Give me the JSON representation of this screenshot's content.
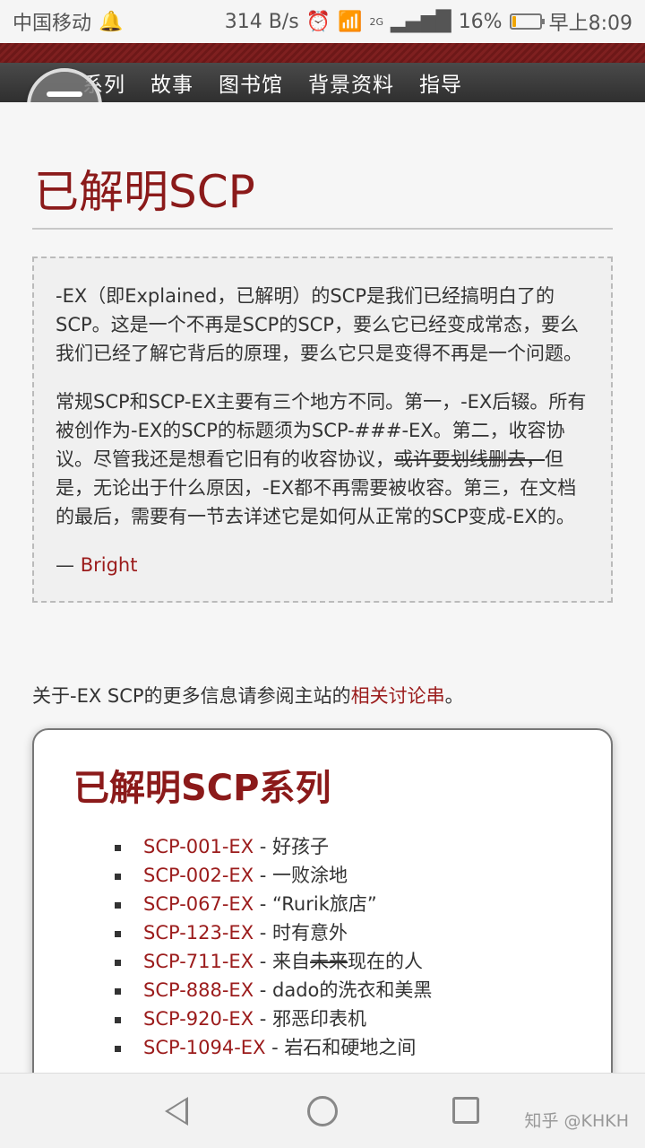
{
  "status": {
    "carrier": "中国移动",
    "speed": "314 B/s",
    "network_tag": "2G",
    "battery_pct": "16%",
    "time": "早上8:09",
    "battery_level": 0.16,
    "battery_color": "#f0a500"
  },
  "nav": {
    "items": [
      "系列",
      "故事",
      "图书馆",
      "背景资料",
      "指导"
    ]
  },
  "page": {
    "title": "已解明SCP",
    "quote": {
      "p1": "-EX（即Explained，已解明）的SCP是我们已经搞明白了的SCP。这是一个不再是SCP的SCP，要么它已经变成常态，要么我们已经了解它背后的原理，要么它只是变得不再是一个问题。",
      "p2_part1": "常规SCP和SCP-EX主要有三个地方不同。第一，-EX后辍。所有被创作为-EX的SCP的标题须为SCP-###-EX。第二，收容协议。尽管我还是想看它旧有的收容协议，",
      "p2_strike": "或许要划线删去，",
      "p2_part2": "但是，无论出于什么原因，-EX都不再需要被收容。第三，在文档的最后，需要有一节去详述它是如何从正常的SCP变成-EX的。",
      "signature_dash": "— ",
      "signature_name": "Bright"
    },
    "info_prefix": "关于-EX SCP的更多信息请参阅主站的",
    "info_link": "相关讨论串",
    "info_suffix": "。"
  },
  "series": {
    "title": "已解明SCP系列",
    "items": [
      {
        "code": "SCP-001-EX",
        "sep": " - ",
        "name": "好孩子"
      },
      {
        "code": "SCP-002-EX",
        "sep": " - ",
        "name": "一败涂地"
      },
      {
        "code": "SCP-067-EX",
        "sep": " - ",
        "name": "“Rurik旅店”"
      },
      {
        "code": "SCP-123-EX",
        "sep": " - ",
        "name": "时有意外"
      },
      {
        "code": "SCP-711-EX",
        "sep": " - ",
        "name_pre": "来自",
        "name_strike": "未来",
        "name_post": "现在的人"
      },
      {
        "code": "SCP-888-EX",
        "sep": " - ",
        "name": "dado的洗衣和美黑"
      },
      {
        "code": "SCP-920-EX",
        "sep": " - ",
        "name": "邪恶印表机"
      },
      {
        "code": "SCP-1094-EX",
        "sep": " - ",
        "name": "岩石和硬地之间"
      }
    ]
  },
  "watermark": "知乎 @KHKH",
  "colors": {
    "accent": "#8b1a1a",
    "link": "#9b1b1b",
    "nav_bg": "#3a3a3a"
  }
}
